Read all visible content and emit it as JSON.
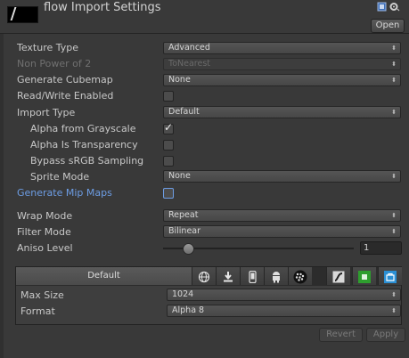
{
  "header": {
    "title": "flow Import Settings",
    "open_label": "Open"
  },
  "fields": {
    "texture_type": {
      "label": "Texture Type",
      "value": "Advanced"
    },
    "non_power_of_2": {
      "label": "Non Power of 2",
      "value": "ToNearest"
    },
    "generate_cubemap": {
      "label": "Generate Cubemap",
      "value": "None"
    },
    "read_write": {
      "label": "Read/Write Enabled",
      "checked": false
    },
    "import_type": {
      "label": "Import Type",
      "value": "Default"
    },
    "alpha_from_grayscale": {
      "label": "Alpha from Grayscale",
      "checked": true
    },
    "alpha_is_transparency": {
      "label": "Alpha Is Transparency",
      "checked": false
    },
    "bypass_srgb": {
      "label": "Bypass sRGB Sampling",
      "checked": false
    },
    "sprite_mode": {
      "label": "Sprite Mode",
      "value": "None"
    },
    "generate_mip_maps": {
      "label": "Generate Mip Maps",
      "checked": false
    },
    "wrap_mode": {
      "label": "Wrap Mode",
      "value": "Repeat"
    },
    "filter_mode": {
      "label": "Filter Mode",
      "value": "Bilinear"
    },
    "aniso_level": {
      "label": "Aniso Level",
      "value": "1",
      "slider_fraction": 0.11
    }
  },
  "platforms": {
    "default_tab": "Default",
    "tabs": [
      "globe-icon",
      "download-icon",
      "phone-icon",
      "android-icon",
      "blackberry-icon",
      "flash-icon",
      "xbox-icon",
      "windows-store-icon"
    ],
    "max_size": {
      "label": "Max Size",
      "value": "1024"
    },
    "format": {
      "label": "Format",
      "value": "Alpha 8"
    }
  },
  "footer": {
    "revert_label": "Revert",
    "apply_label": "Apply"
  },
  "colors": {
    "background": "#393939",
    "highlight_label": "#6d9de4"
  }
}
